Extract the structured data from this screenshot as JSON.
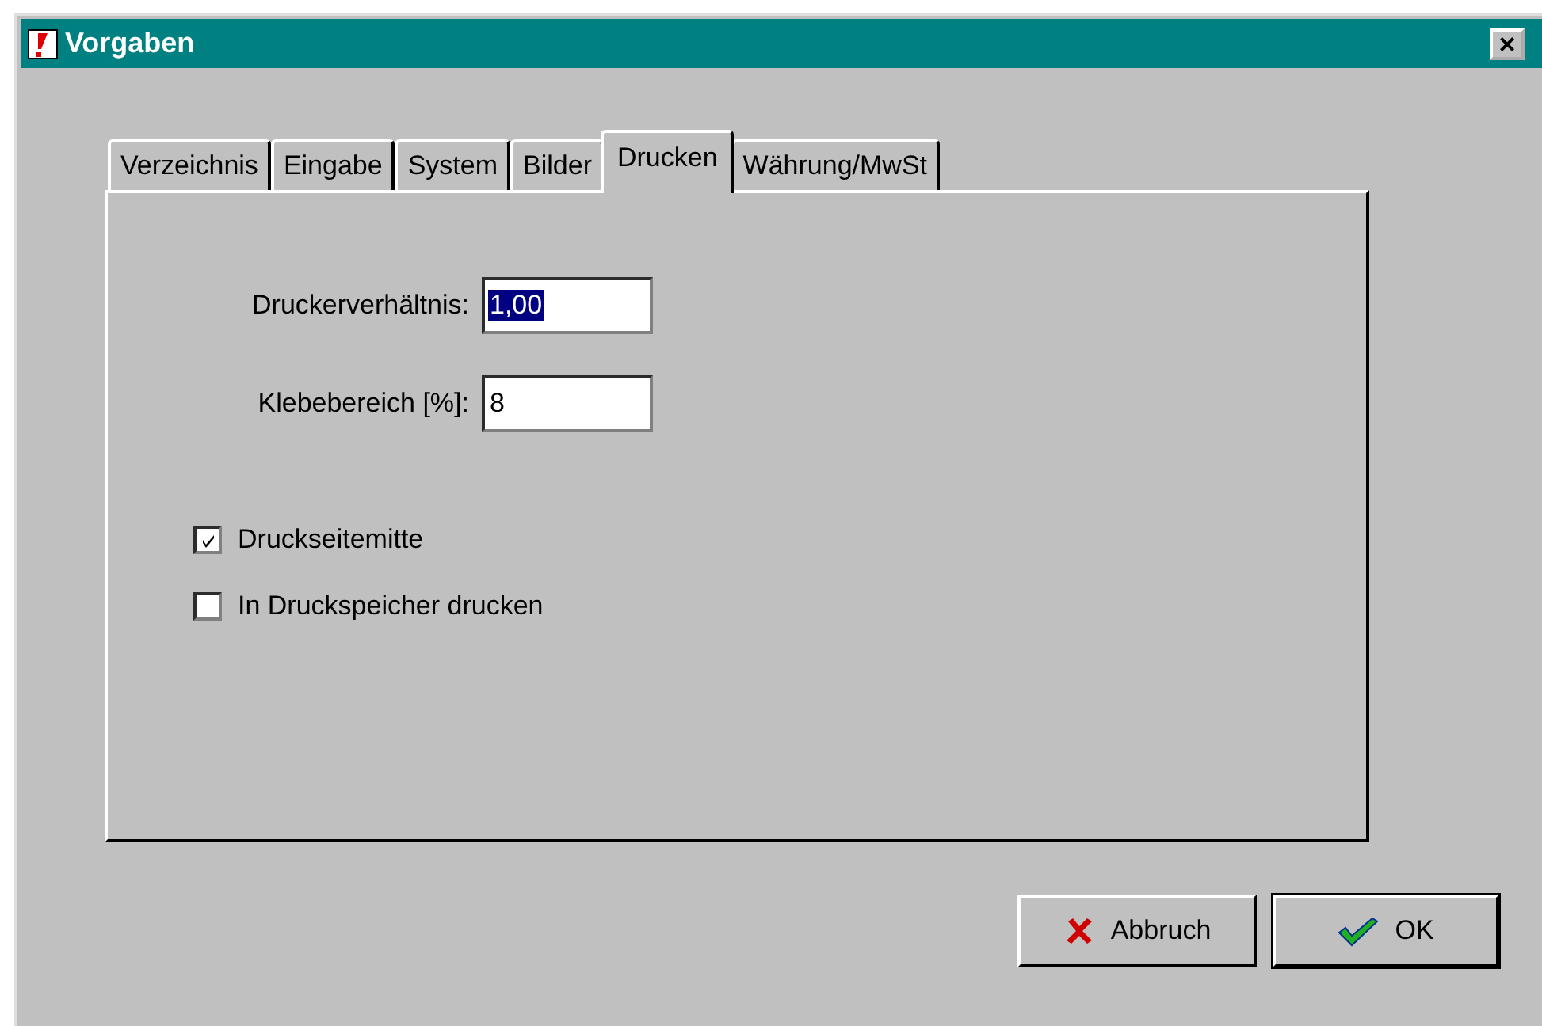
{
  "window": {
    "title": "Vorgaben",
    "close": "×"
  },
  "tabs": [
    {
      "label": "Verzeichnis",
      "selected": false
    },
    {
      "label": "Eingabe",
      "selected": false
    },
    {
      "label": "System",
      "selected": false
    },
    {
      "label": "Bilder",
      "selected": false
    },
    {
      "label": "Drucken",
      "selected": true
    },
    {
      "label": "Währung/MwSt",
      "selected": false
    }
  ],
  "fields": [
    {
      "label": "Druckerverhältnis:",
      "value": "1,00",
      "highlighted": true
    },
    {
      "label": "Klebebereich [%]:",
      "value": "8",
      "highlighted": false
    }
  ],
  "checkboxes": [
    {
      "label": "Druckseitemitte",
      "checked": true
    },
    {
      "label": "In Druckspeicher drucken",
      "checked": false
    }
  ],
  "buttons": [
    {
      "label": "Abbruch",
      "kind": "cancel"
    },
    {
      "label": "OK",
      "kind": "ok"
    }
  ]
}
